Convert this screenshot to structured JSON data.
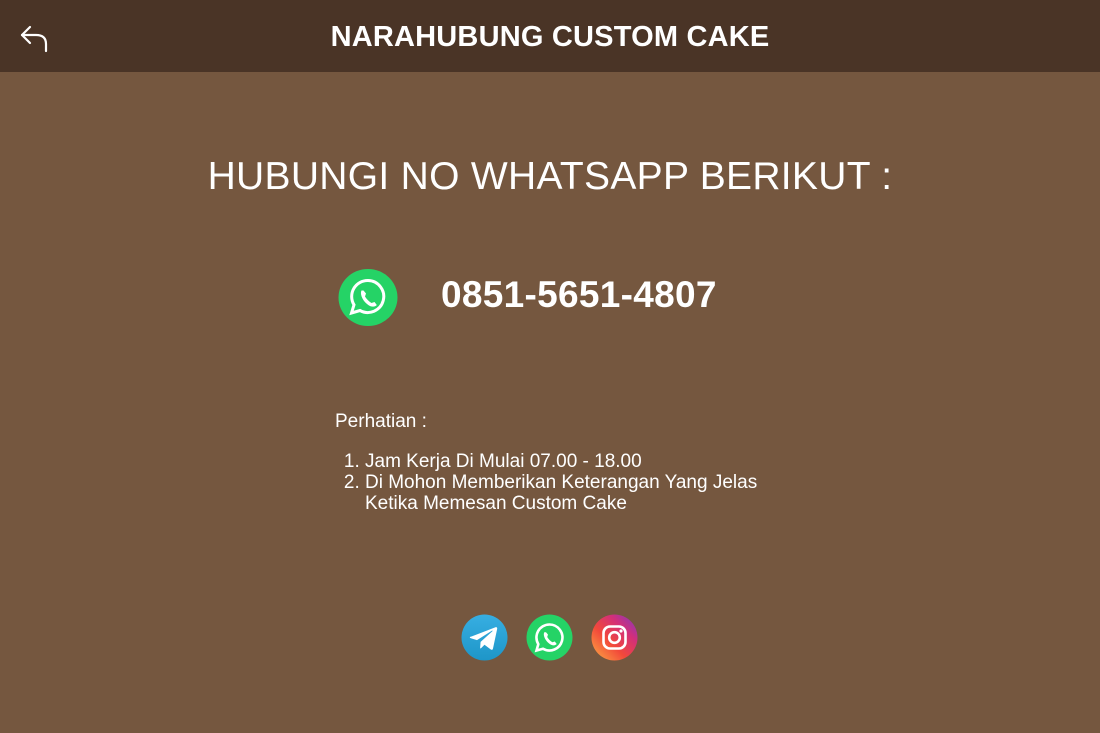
{
  "header": {
    "title": "NARAHUBUNG CUSTOM CAKE",
    "back_icon": "back-arrow-icon"
  },
  "main": {
    "headline": "HUBUNGI NO WHATSAPP BERIKUT :",
    "whatsapp_icon": "whatsapp-icon",
    "phone_number": "0851-5651-4807"
  },
  "notes": {
    "title": "Perhatian :",
    "items": [
      "Jam Kerja Di Mulai 07.00 - 18.00",
      "Di Mohon Memberikan Keterangan Yang Jelas Ketika Memesan Custom Cake"
    ]
  },
  "socials": [
    {
      "icon": "telegram-icon"
    },
    {
      "icon": "whatsapp-icon"
    },
    {
      "icon": "instagram-icon"
    }
  ],
  "colors": {
    "background": "#75573f",
    "header": "#4a3426",
    "whatsapp": "#25d366",
    "telegram": "#2aa3dc",
    "text": "#ffffff"
  }
}
